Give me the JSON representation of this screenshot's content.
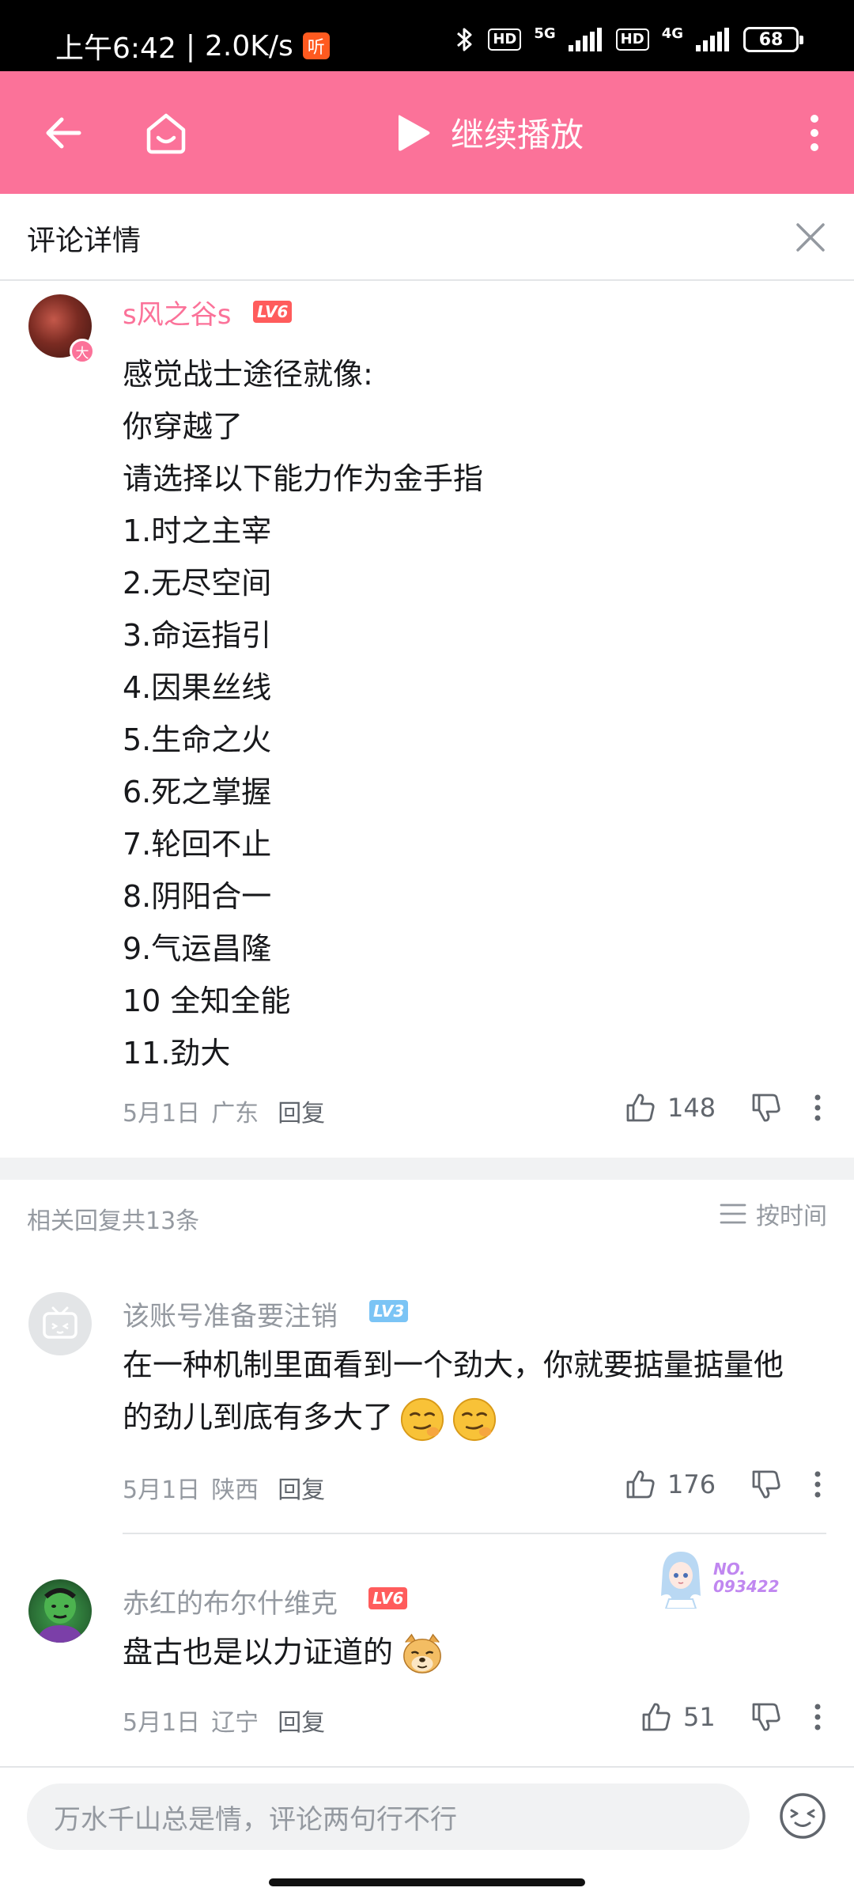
{
  "status_bar": {
    "time": "上午6:42",
    "speed": "2.0K/s",
    "listen_badge": "听",
    "hd1": "HD",
    "net1": "5G",
    "hd2": "HD",
    "net2": "4G",
    "battery": "68"
  },
  "header": {
    "play_label": "继续播放",
    "accent_color": "#fb7299"
  },
  "detail": {
    "title": "评论详情"
  },
  "main_comment": {
    "avatar_badge": "大",
    "username": "s风之谷s",
    "level": "LV6",
    "lines": [
      "感觉战士途径就像:",
      "你穿越了",
      "请选择以下能力作为金手指",
      "1.时之主宰",
      "2.无尽空间",
      "3.命运指引",
      "4.因果丝线",
      "5.生命之火",
      "6.死之掌握",
      "7.轮回不止",
      "8.阴阳合一",
      "9.气运昌隆",
      "10 全知全能",
      "11.劲大"
    ],
    "date": "5月1日",
    "region": "广东",
    "reply_label": "回复",
    "likes": "148"
  },
  "replies_header": {
    "count_text": "相关回复共13条",
    "sort_label": "按时间"
  },
  "replies": [
    {
      "username": "该账号准备要注销",
      "level": "LV3",
      "text_line1": "在一种机制里面看到一个劲大，你就要掂量掂量他",
      "text_line2": "的劲儿到底有多大了",
      "date": "5月1日",
      "region": "陕西",
      "reply_label": "回复",
      "likes": "176"
    },
    {
      "username": "赤红的布尔什维克",
      "level": "LV6",
      "text": "盘古也是以力证道的",
      "date": "5月1日",
      "region": "辽宁",
      "reply_label": "回复",
      "likes": "51",
      "fan_badge_line1": "NO.",
      "fan_badge_line2": "093422"
    }
  ],
  "bottom": {
    "input_placeholder": "万水千山总是情，评论两句行不行"
  }
}
